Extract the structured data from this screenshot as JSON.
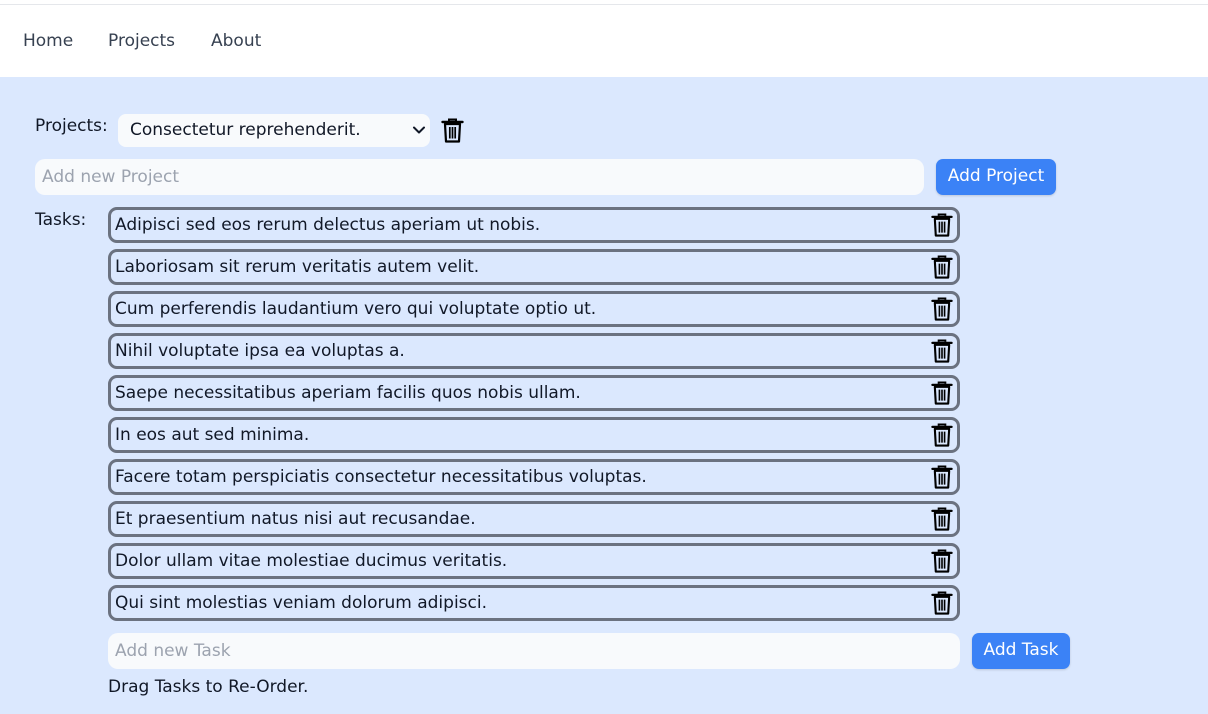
{
  "nav": {
    "items": [
      {
        "label": "Home"
      },
      {
        "label": "Projects"
      },
      {
        "label": "About"
      }
    ]
  },
  "projects": {
    "label": "Projects:",
    "selected": "Consectetur reprehenderit.",
    "new_placeholder": "Add new Project",
    "add_label": "Add Project",
    "delete_icon": "trash-icon"
  },
  "tasks": {
    "label": "Tasks:",
    "items": [
      {
        "text": "Adipisci sed eos rerum delectus aperiam ut nobis."
      },
      {
        "text": "Laboriosam sit rerum veritatis autem velit."
      },
      {
        "text": "Cum perferendis laudantium vero qui voluptate optio ut."
      },
      {
        "text": "Nihil voluptate ipsa ea voluptas a."
      },
      {
        "text": "Saepe necessitatibus aperiam facilis quos nobis ullam."
      },
      {
        "text": "In eos aut sed minima."
      },
      {
        "text": "Facere totam perspiciatis consectetur necessitatibus voluptas."
      },
      {
        "text": "Et praesentium natus nisi aut recusandae."
      },
      {
        "text": "Dolor ullam vitae molestiae ducimus veritatis."
      },
      {
        "text": "Qui sint molestias veniam dolorum adipisci."
      }
    ],
    "new_placeholder": "Add new Task",
    "add_label": "Add Task",
    "hint": "Drag Tasks to Re-Order."
  },
  "colors": {
    "accent": "#3b82f6",
    "background": "#dbe8fe",
    "task_border": "#6b7280"
  }
}
